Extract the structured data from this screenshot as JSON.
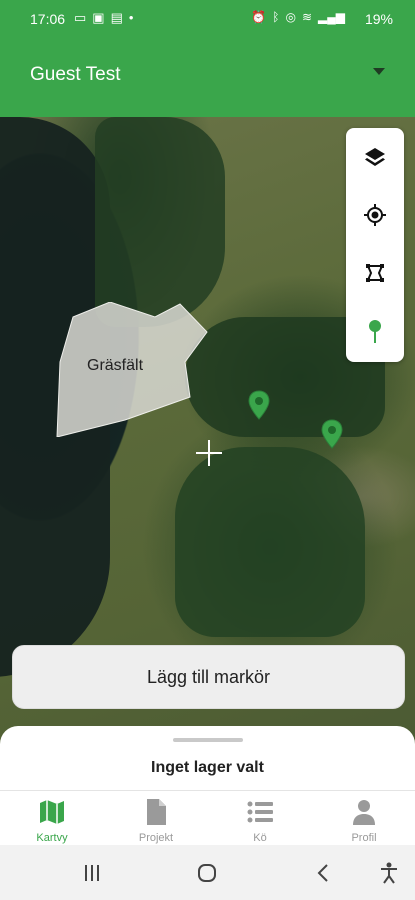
{
  "status": {
    "time": "17:06",
    "battery": "19%",
    "left_icons": [
      "screen-icon",
      "gallery-icon",
      "news-icon",
      "dot-icon"
    ],
    "right_icons": [
      "alarm-icon",
      "bluetooth-icon",
      "gamepad-icon",
      "wifi-icon",
      "signal-icon"
    ]
  },
  "header": {
    "title": "Guest Test",
    "dropdown_icon": "caret-down-icon"
  },
  "map": {
    "field_label": "Gräsfält",
    "markers": [
      "map-marker",
      "map-marker"
    ]
  },
  "tools": [
    "layers-icon",
    "my-location-icon",
    "polygon-icon",
    "pin-icon"
  ],
  "add_marker_label": "Lägg till markör",
  "sheet": {
    "title": "Inget lager valt"
  },
  "tabs": [
    {
      "label": "Kartvy",
      "icon": "map-icon",
      "active": true
    },
    {
      "label": "Projekt",
      "icon": "document-icon",
      "active": false
    },
    {
      "label": "Kö",
      "icon": "list-icon",
      "active": false
    },
    {
      "label": "Profil",
      "icon": "person-icon",
      "active": false
    }
  ],
  "colors": {
    "accent": "#3aa64b",
    "inactive": "#9a9a9a"
  }
}
